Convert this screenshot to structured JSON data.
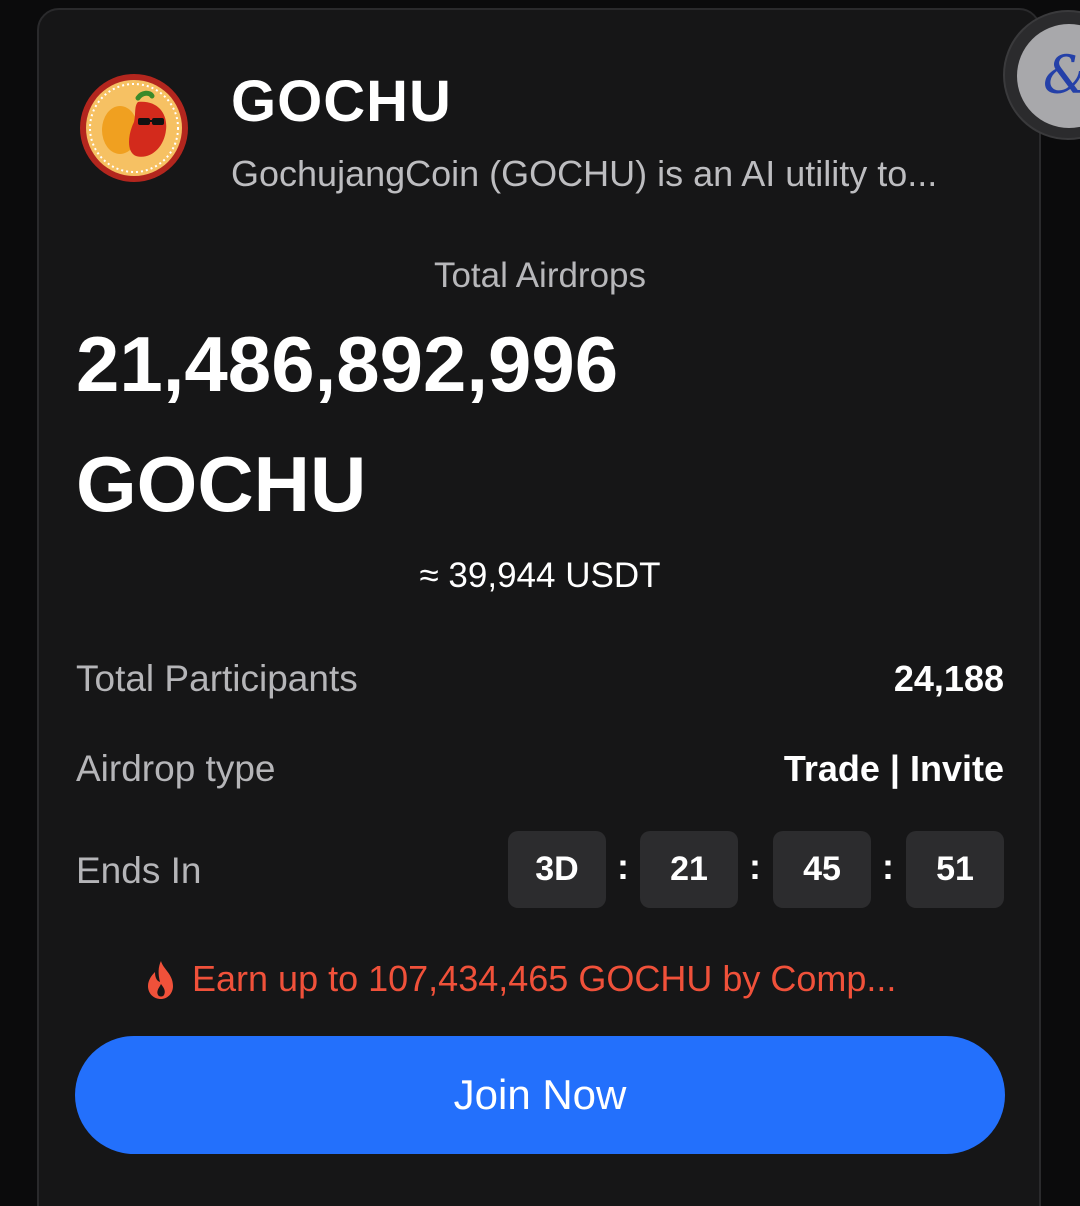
{
  "token": {
    "name": "GOCHU",
    "description": "GochujangCoin (GOCHU) is an AI utility to..."
  },
  "airdrop": {
    "total_label": "Total Airdrops",
    "total_amount": "21,486,892,996",
    "total_unit": "GOCHU",
    "usdt_value": "≈ 39,944 USDT"
  },
  "details": {
    "participants_label": "Total Participants",
    "participants_value": "24,188",
    "type_label": "Airdrop type",
    "type_value": "Trade | Invite",
    "ends_label": "Ends In"
  },
  "countdown": {
    "days": "3D",
    "hours": "21",
    "minutes": "45",
    "seconds": "51",
    "separator": ":"
  },
  "promo": {
    "text": "Earn up to 107,434,465 GOCHU by Comp..."
  },
  "actions": {
    "join_label": "Join Now"
  },
  "colors": {
    "background": "#161617",
    "accent_blue": "#2370fc",
    "promo_red": "#f0513a"
  },
  "icons": {
    "floating_button": "link-icon",
    "promo": "flame-icon"
  }
}
